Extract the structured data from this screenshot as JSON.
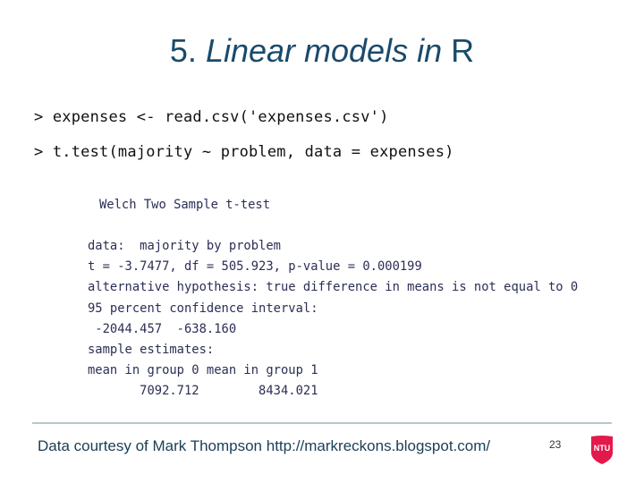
{
  "slide": {
    "title_number": "5.",
    "title_italic": "Linear models in",
    "title_plain": "R",
    "commands": [
      "> expenses <- read.csv('expenses.csv')",
      "> t.test(majority ~ problem, data = expenses)"
    ],
    "output": {
      "heading": "Welch Two Sample t-test",
      "lines": [
        "data:  majority by problem",
        "t = -3.7477, df = 505.923, p-value = 0.000199",
        "alternative hypothesis: true difference in means is not equal to 0",
        "95 percent confidence interval:",
        " -2044.457  -638.160",
        "sample estimates:",
        "mean in group 0 mean in group 1",
        "       7092.712        8434.021"
      ]
    },
    "footer": "Data courtesy of Mark Thompson http://markreckons.blogspot.com/",
    "page_number": "23",
    "logo_text": "NTU",
    "colors": {
      "title": "#1a4a6b",
      "logo": "#e3194b"
    }
  }
}
